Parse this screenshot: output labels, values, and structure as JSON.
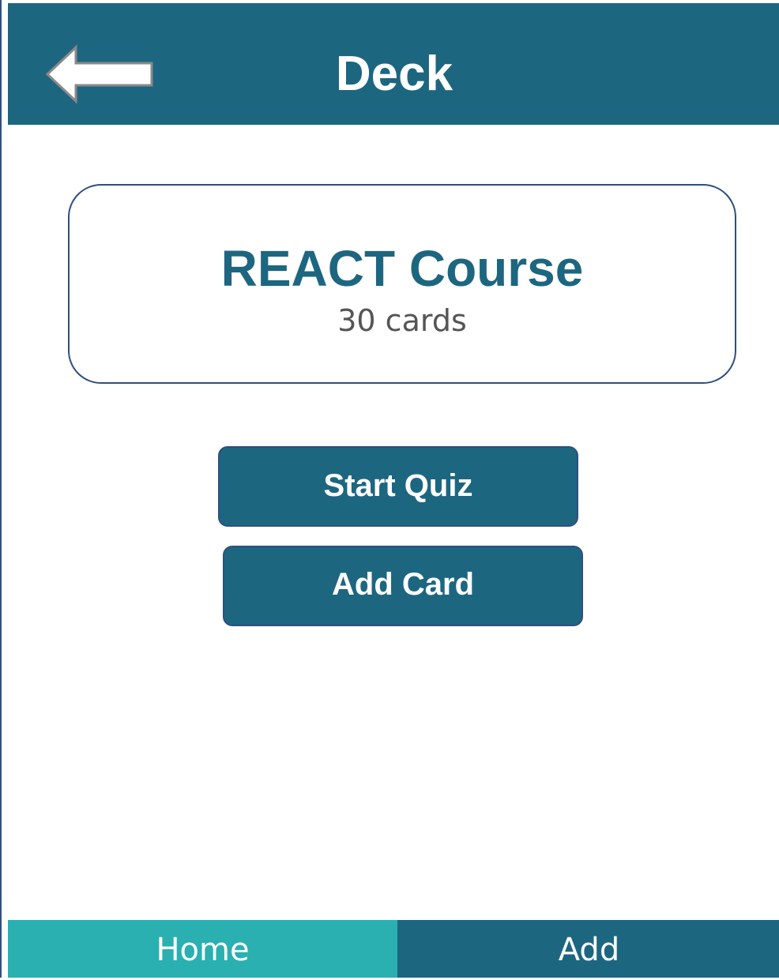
{
  "header": {
    "title": "Deck",
    "back_icon": "arrow-left-icon"
  },
  "deck": {
    "name": "REACT Course",
    "card_count": "30 cards"
  },
  "actions": {
    "start_quiz_label": "Start Quiz",
    "add_card_label": "Add Card"
  },
  "tabs": [
    {
      "label": "Home",
      "active": true
    },
    {
      "label": "Add",
      "active": false
    }
  ],
  "colors": {
    "primary": "#1d6680",
    "active_tab": "#2ab0b0",
    "border": "#2f4f7f",
    "secondary_text": "#555555"
  }
}
